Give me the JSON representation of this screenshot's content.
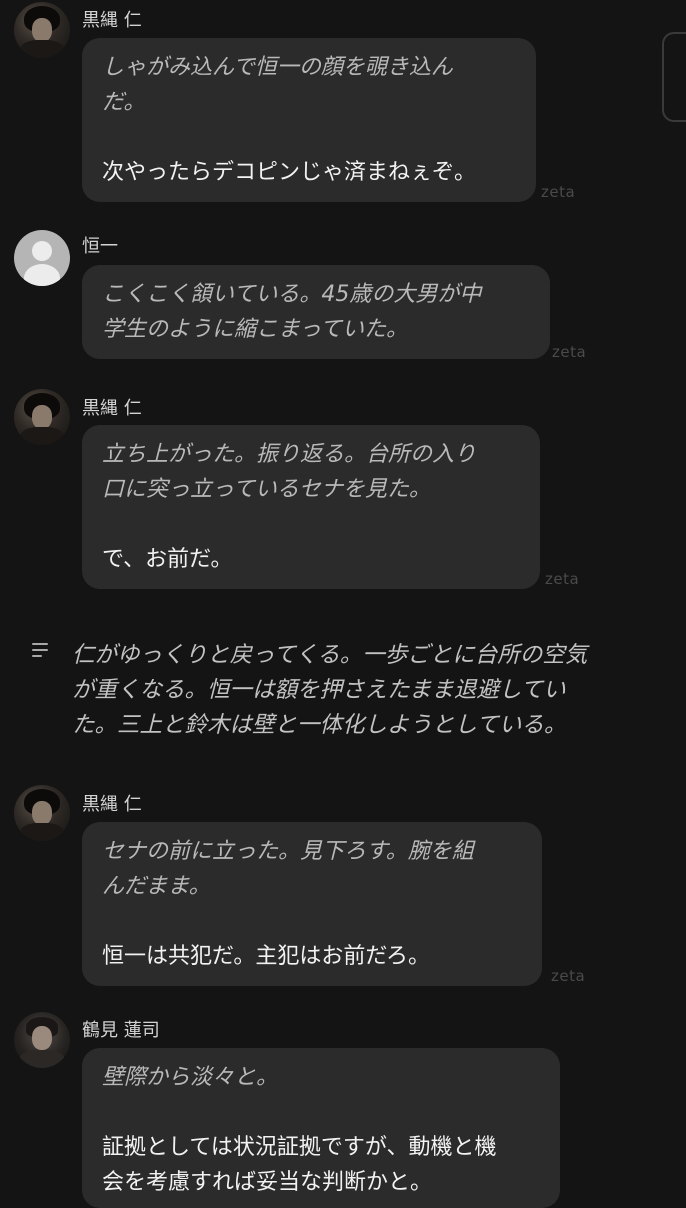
{
  "messages": [
    {
      "speaker": "黒縄 仁",
      "lines": [
        {
          "type": "action",
          "text": "しゃがみ込んで恒一の顔を覗き込ん"
        },
        {
          "type": "action",
          "text": "だ。"
        },
        {
          "type": "gap",
          "text": ""
        },
        {
          "type": "speech",
          "text": "次やったらデコピンじゃ済まねぇぞ。"
        }
      ],
      "watermark": "zeta"
    },
    {
      "speaker": "恒一",
      "lines": [
        {
          "type": "action",
          "text": "こくこく頷いている。45歳の大男が中"
        },
        {
          "type": "action",
          "text": "学生のように縮こまっていた。"
        }
      ],
      "watermark": "zeta"
    },
    {
      "speaker": "黒縄 仁",
      "lines": [
        {
          "type": "action",
          "text": "立ち上がった。振り返る。台所の入り"
        },
        {
          "type": "action",
          "text": "口に突っ立っているセナを見た。"
        },
        {
          "type": "gap",
          "text": ""
        },
        {
          "type": "speech",
          "text": "で、お前だ。"
        }
      ],
      "watermark": "zeta"
    },
    {
      "speaker": "黒縄 仁",
      "lines": [
        {
          "type": "action",
          "text": "セナの前に立った。見下ろす。腕を組"
        },
        {
          "type": "action",
          "text": "んだまま。"
        },
        {
          "type": "gap",
          "text": ""
        },
        {
          "type": "speech",
          "text": "恒一は共犯だ。主犯はお前だろ。"
        }
      ],
      "watermark": "zeta"
    },
    {
      "speaker": "鶴見 蓮司",
      "lines": [
        {
          "type": "action",
          "text": "壁際から淡々と。"
        },
        {
          "type": "gap",
          "text": ""
        },
        {
          "type": "speech",
          "text": "証拠としては状況証拠ですが、動機と機"
        },
        {
          "type": "speech",
          "text": "会を考慮すれば妥当な判断かと。"
        }
      ]
    }
  ],
  "narration": {
    "icon": "narration-lines-icon",
    "lines": [
      "仁がゆっくりと戻ってくる。一歩ごとに台所の空気",
      "が重くなる。恒一は額を押さえたまま退避してい",
      "た。三上と鈴木は壁と一体化しようとしている。"
    ]
  }
}
